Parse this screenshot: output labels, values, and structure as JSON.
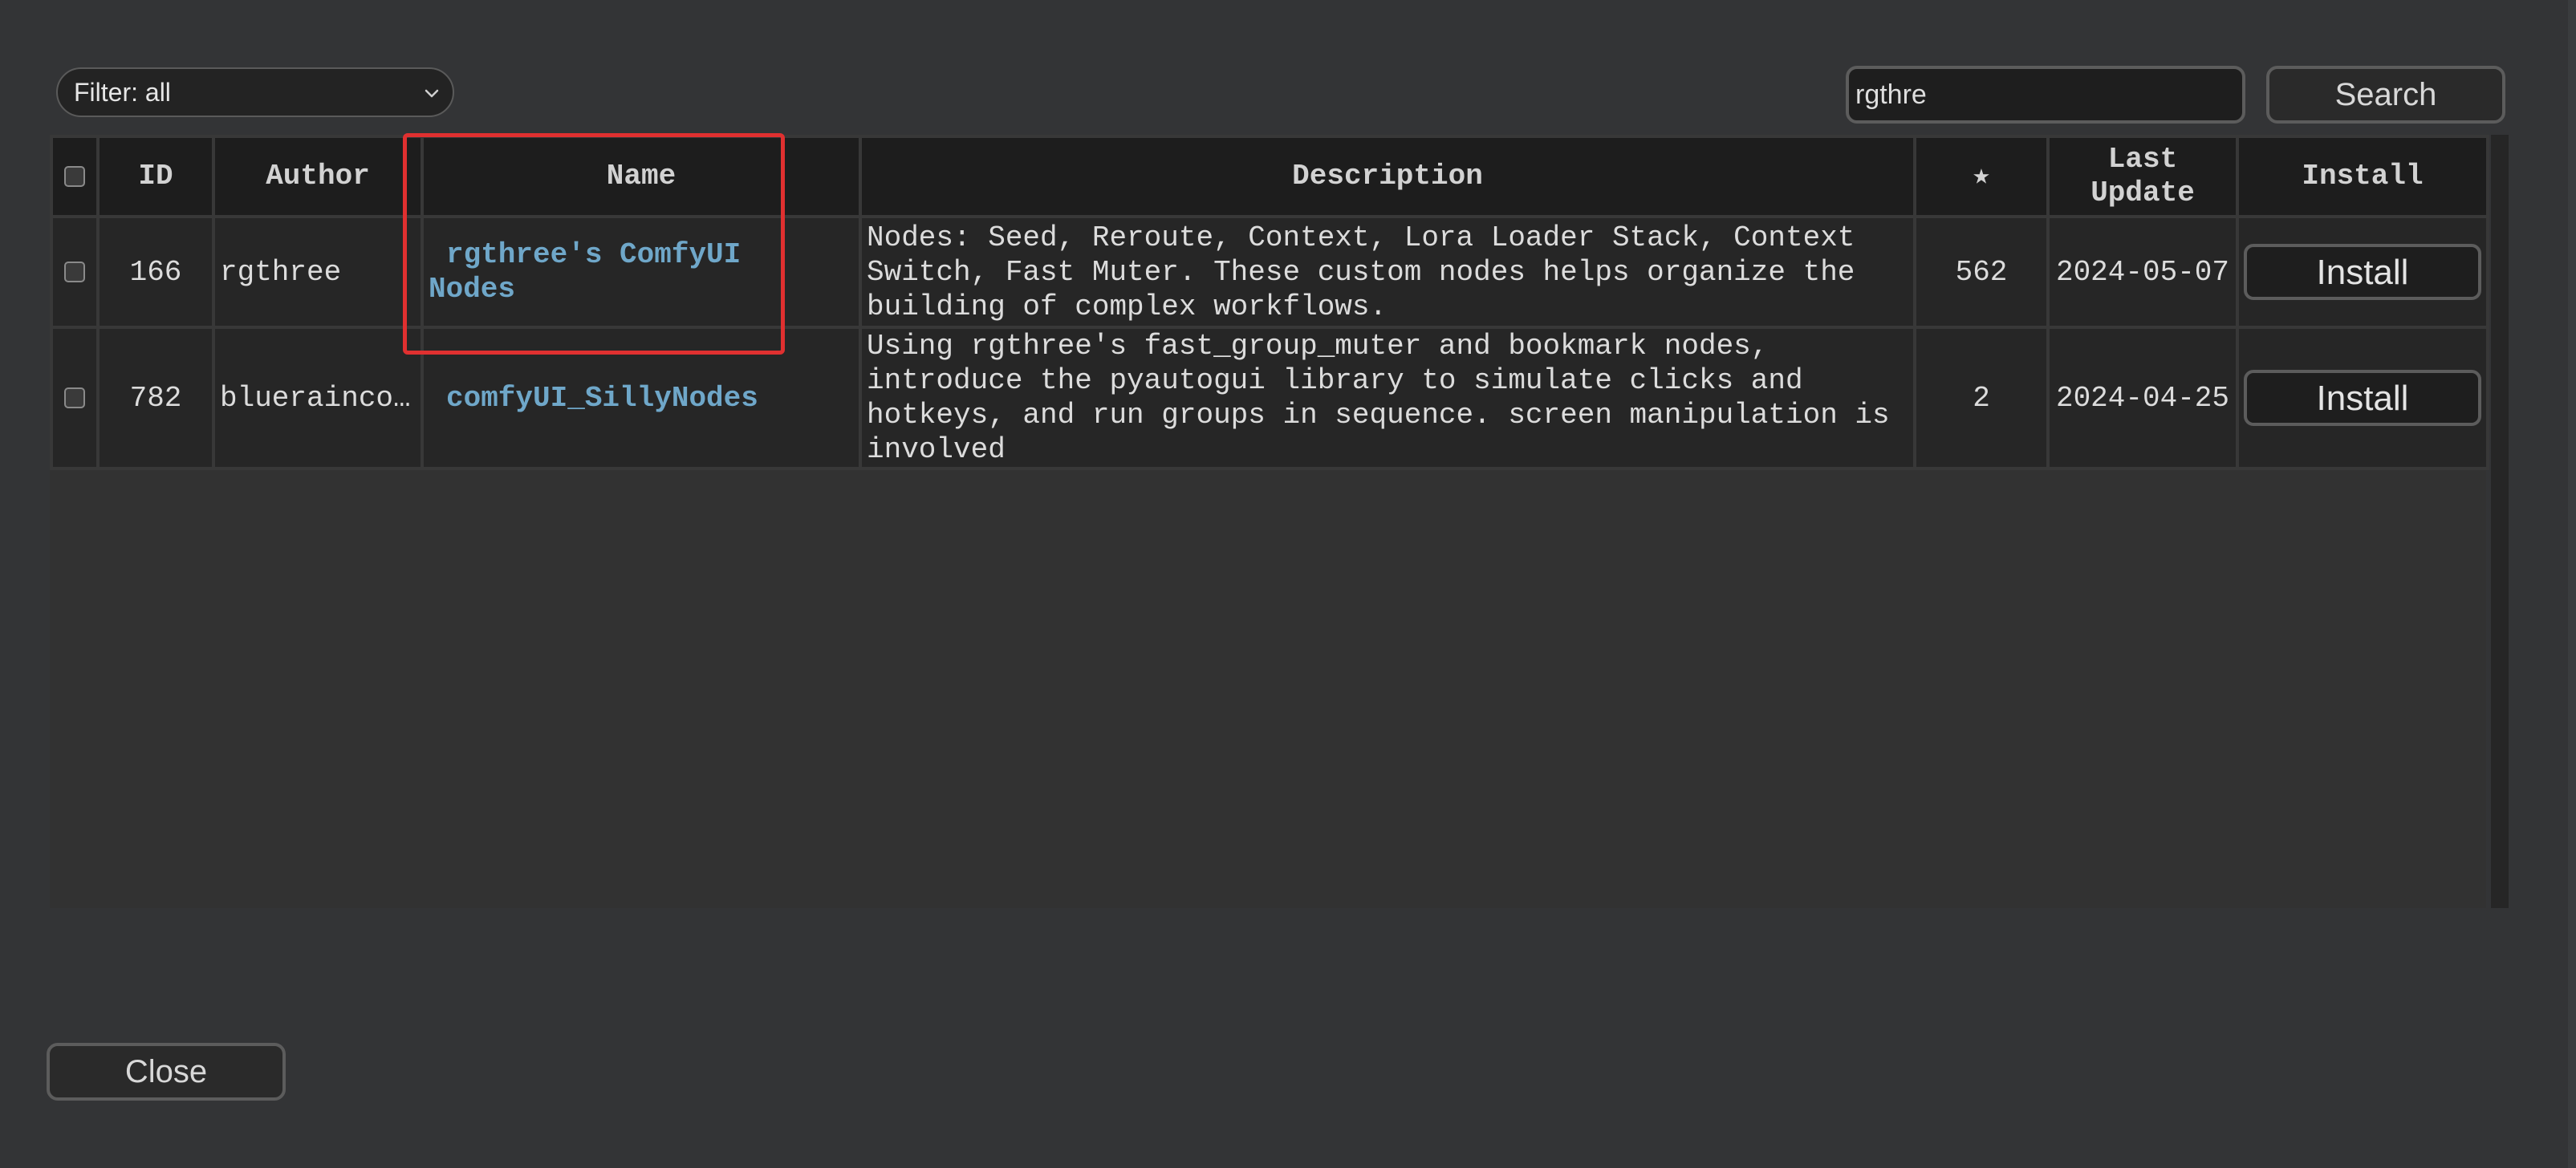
{
  "toolbar": {
    "filter_label": "Filter: all",
    "search_value": "rgthre",
    "search_button": "Search"
  },
  "table": {
    "headers": {
      "id": "ID",
      "author": "Author",
      "name": "Name",
      "description": "Description",
      "stars": "★",
      "last_update": "Last Update",
      "install": "Install"
    },
    "rows": [
      {
        "id": "166",
        "author": "rgthree",
        "name": "rgthree's ComfyUI Nodes",
        "description": "Nodes: Seed, Reroute, Context, Lora Loader Stack, Context Switch, Fast Muter. These custom nodes helps organize the building of complex workflows.",
        "stars": "562",
        "last_update": "2024-05-07",
        "install_label": "Install"
      },
      {
        "id": "782",
        "author": "bluerainco…",
        "name": "comfyUI_SillyNodes",
        "description": "Using rgthree's fast_group_muter and bookmark nodes, introduce the pyautogui library to simulate clicks and hotkeys, and run groups in sequence. screen manipulation is involved",
        "stars": "2",
        "last_update": "2024-04-25",
        "install_label": "Install"
      }
    ]
  },
  "footer": {
    "close_label": "Close"
  },
  "icons": {
    "filter_chevron": "chevron-down-icon"
  },
  "colors": {
    "link": "#6fa7c9",
    "highlight": "#e03030"
  }
}
